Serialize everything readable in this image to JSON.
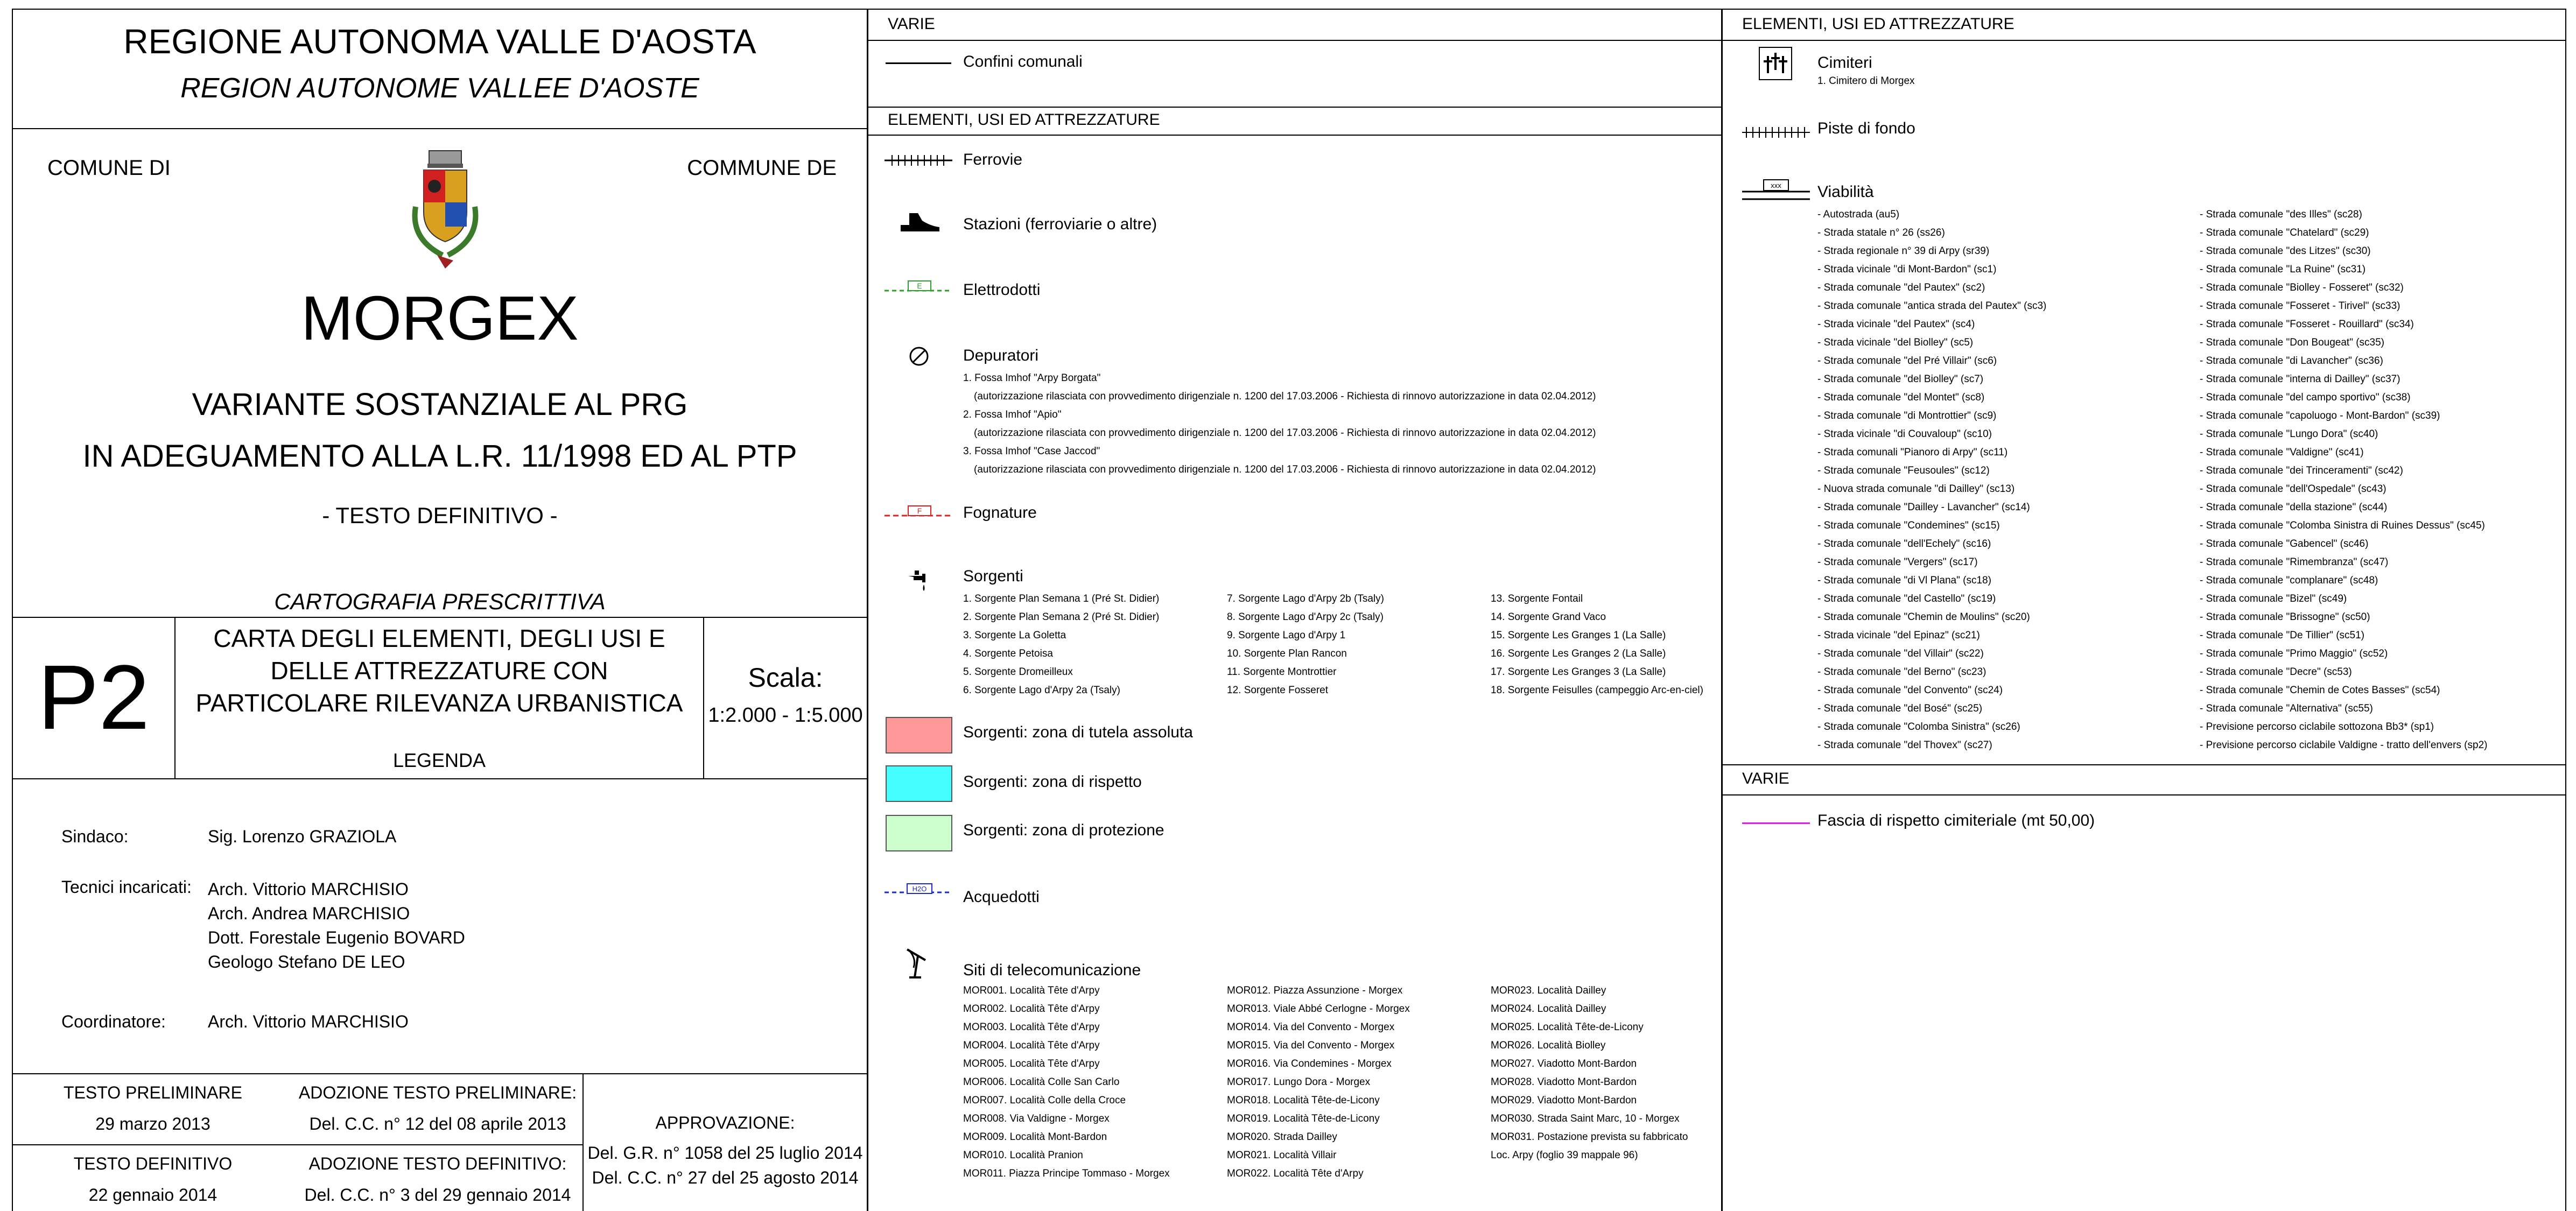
{
  "title_block": {
    "region_it": "REGIONE AUTONOMA VALLE D'AOSTA",
    "region_fr": "REGION AUTONOME VALLEE D'AOSTE",
    "comune_it": "COMUNE DI",
    "comune_fr": "COMMUNE DE",
    "town": "MORGEX",
    "variant_line1": "VARIANTE SOSTANZIALE AL PRG",
    "variant_line2": "IN ADEGUAMENTO ALLA L.R. 11/1998 ED AL PTP",
    "testo": "- TESTO DEFINITIVO -",
    "cartografia": "CARTOGRAFIA PRESCRITTIVA",
    "sheet_code": "P2",
    "sheet_title_1": "CARTA DEGLI ELEMENTI, DEGLI USI E",
    "sheet_title_2": "DELLE ATTREZZATURE CON",
    "sheet_title_3": "PARTICOLARE RILEVANZA URBANISTICA",
    "legenda": "LEGENDA",
    "scala_label": "Scala:",
    "scala_value": "1:2.000 - 1:5.000",
    "sindaco_label": "Sindaco:",
    "sindaco": "Sig. Lorenzo GRAZIOLA",
    "tecnici_label": "Tecnici incaricati:",
    "tecnici": [
      "Arch. Vittorio MARCHISIO",
      "Arch. Andrea MARCHISIO",
      "Dott. Forestale Eugenio BOVARD",
      "Geologo Stefano DE LEO"
    ],
    "coordinatore_label": "Coordinatore:",
    "coordinatore": "Arch. Vittorio MARCHISIO",
    "testo_prelim": "TESTO PRELIMINARE",
    "testo_prelim_date": "29 marzo 2013",
    "adozione_prelim": "ADOZIONE TESTO PRELIMINARE:",
    "adozione_prelim_val": "Del. C.C. n° 12 del 08 aprile 2013",
    "testo_def": "TESTO DEFINITIVO",
    "testo_def_date": "22 gennaio 2014",
    "adozione_def": "ADOZIONE TESTO DEFINITIVO:",
    "adozione_def_val": "Del. C.C. n° 3 del 29 gennaio 2014",
    "approvazione": "APPROVAZIONE:",
    "approvazione_1": "Del. G.R. n° 1058 del 25 luglio 2014",
    "approvazione_2": "Del. C.C. n° 27 del 25 agosto 2014"
  },
  "middle": {
    "varie_header": "VARIE",
    "confini": "Confini comunali",
    "elementi_header": "ELEMENTI, USI ED ATTREZZATURE",
    "ferrovie": "Ferrovie",
    "stazioni": "Stazioni (ferroviarie o altre)",
    "elettrodotti": "Elettrodotti",
    "elettro_symbol": "E",
    "depuratori": "Depuratori",
    "depuratori_items": [
      "1. Fossa Imhof \"Arpy Borgata\"",
      "(autorizzazione rilasciata con provvedimento dirigenziale n. 1200 del 17.03.2006 - Richiesta di rinnovo autorizzazione in data 02.04.2012)",
      "2. Fossa Imhof \"Apio\"",
      "(autorizzazione rilasciata con provvedimento dirigenziale n. 1200 del 17.03.2006 - Richiesta di rinnovo autorizzazione in data 02.04.2012)",
      "3. Fossa Imhof \"Case Jaccod\"",
      "(autorizzazione rilasciata con provvedimento dirigenziale n. 1200 del 17.03.2006 - Richiesta di rinnovo autorizzazione in data 02.04.2012)"
    ],
    "fognature": "Fognature",
    "fogn_symbol": "F",
    "sorgenti": "Sorgenti",
    "sorgenti_items": [
      "1. Sorgente Plan Semana 1 (Pré St. Didier)",
      "7. Sorgente Lago d'Arpy 2b (Tsaly)",
      "13. Sorgente Fontail",
      "2. Sorgente Plan Semana 2 (Pré St. Didier)",
      "8. Sorgente Lago d'Arpy 2c (Tsaly)",
      "14. Sorgente Grand Vaco",
      "3. Sorgente La Goletta",
      "9. Sorgente Lago d'Arpy 1",
      "15. Sorgente Les Granges 1 (La Salle)",
      "4. Sorgente Petoisa",
      "10. Sorgente Plan Rancon",
      "16. Sorgente Les Granges 2 (La Salle)",
      "5. Sorgente Dromeilleux",
      "11. Sorgente Montrottier",
      "17. Sorgente Les Granges 3 (La Salle)",
      "6. Sorgente Lago d'Arpy 2a (Tsaly)",
      "12. Sorgente Fosseret",
      "18. Sorgente Feisulles (campeggio Arc-en-ciel)"
    ],
    "zona_tutela": "Sorgenti: zona di tutela assoluta",
    "zona_rispetto": "Sorgenti: zona di rispetto",
    "zona_protezione": "Sorgenti: zona di protezione",
    "color_tutela": "#ff9999",
    "color_rispetto": "#44ffff",
    "color_protezione": "#ccffcc",
    "acquedotti": "Acquedotti",
    "acq_symbol": "H2O",
    "siti": "Siti di telecomunicazione",
    "siti_items": [
      "MOR001. Località Tête d'Arpy",
      "MOR012. Piazza Assunzione - Morgex",
      "MOR023. Località Dailley",
      "MOR002. Località Tête d'Arpy",
      "MOR013. Viale Abbé Cerlogne - Morgex",
      "MOR024. Località Dailley",
      "MOR003. Località Tête d'Arpy",
      "MOR014. Via del Convento - Morgex",
      "MOR025. Località Tête-de-Licony",
      "MOR004. Località Tête d'Arpy",
      "MOR015. Via del Convento - Morgex",
      "MOR026. Località Biolley",
      "MOR005. Località Tête d'Arpy",
      "MOR016. Via Condemines - Morgex",
      "MOR027. Viadotto Mont-Bardon",
      "MOR006. Località Colle San Carlo",
      "MOR017. Lungo Dora - Morgex",
      "MOR028. Viadotto Mont-Bardon",
      "MOR007. Località Colle della Croce",
      "MOR018. Località Tête-de-Licony",
      "MOR029. Viadotto Mont-Bardon",
      "MOR008. Via Valdigne - Morgex",
      "MOR019. Località Tête-de-Licony",
      "MOR030. Strada Saint Marc, 10 - Morgex",
      "MOR009. Località Mont-Bardon",
      "MOR020. Strada Dailley",
      "MOR031. Postazione prevista su fabbricato",
      "MOR010. Località Pranion",
      "MOR021. Località Villair",
      "Loc. Arpy (foglio 39 mappale 96)",
      "MOR011. Piazza Principe Tommaso - Morgex",
      "MOR022. Località Tête d'Arpy",
      ""
    ]
  },
  "right": {
    "elementi_header": "ELEMENTI, USI ED ATTREZZATURE",
    "cimiteri": "Cimiteri",
    "cimiteri_item": "1. Cimitero di Morgex",
    "piste": "Piste di fondo",
    "viabilita": "Viabilità",
    "via_symbol": "xxx",
    "viabilita_items": [
      "- Autostrada (au5)",
      "- Strada comunale \"des Illes\" (sc28)",
      "- Strada statale n° 26 (ss26)",
      "- Strada comunale \"Chatelard\" (sc29)",
      "- Strada regionale n° 39 di Arpy (sr39)",
      "- Strada comunale \"des Litzes\" (sc30)",
      "- Strada vicinale \"di Mont-Bardon\" (sc1)",
      "- Strada comunale \"La Ruine\" (sc31)",
      "- Strada comunale \"del Pautex\" (sc2)",
      "- Strada comunale \"Biolley - Fosseret\" (sc32)",
      "- Strada comunale \"antica strada del Pautex\" (sc3)",
      "- Strada comunale \"Fosseret - Tirivel\" (sc33)",
      "- Strada vicinale \"del Pautex\" (sc4)",
      "- Strada comunale \"Fosseret - Rouillard\" (sc34)",
      "- Strada vicinale \"del Biolley\" (sc5)",
      "- Strada comunale \"Don Bougeat\" (sc35)",
      "- Strada comunale \"del Pré Villair\" (sc6)",
      "- Strada comunale \"di Lavancher\" (sc36)",
      "- Strada comunale \"del Biolley\" (sc7)",
      "- Strada comunale \"interna di Dailley\" (sc37)",
      "- Strada comunale \"del Montet\" (sc8)",
      "- Strada comunale \"del campo sportivo\" (sc38)",
      "- Strada comunale \"di Montrottier\" (sc9)",
      "- Strada comunale \"capoluogo - Mont-Bardon\" (sc39)",
      "- Strada vicinale \"di Couvaloup\" (sc10)",
      "- Strada comunale \"Lungo Dora\" (sc40)",
      "- Strada comunali \"Pianoro di Arpy\" (sc11)",
      "- Strada comunale \"Valdigne\" (sc41)",
      "- Strada comunale \"Feusoules\" (sc12)",
      "- Strada comunale \"dei Trinceramenti\" (sc42)",
      "- Nuova strada comunale \"di Dailley\" (sc13)",
      "- Strada comunale \"dell'Ospedale\" (sc43)",
      "- Strada comunale \"Dailley - Lavancher\" (sc14)",
      "- Strada comunale \"della stazione\" (sc44)",
      "- Strada comunale \"Condemines\" (sc15)",
      "- Strada comunale \"Colomba Sinistra di Ruines Dessus\" (sc45)",
      "- Strada comunale \"dell'Echely\" (sc16)",
      "- Strada comunale \"Gabencel\" (sc46)",
      "- Strada comunale \"Vergers\" (sc17)",
      "- Strada comunale \"Rimembranza\" (sc47)",
      "- Strada comunale \"di Vl Plana\" (sc18)",
      "- Strada comunale \"complanare\" (sc48)",
      "- Strada comunale \"del Castello\" (sc19)",
      "- Strada comunale \"Bizel\" (sc49)",
      "- Strada comunale \"Chemin de Moulins\" (sc20)",
      "- Strada comunale \"Brissogne\" (sc50)",
      "- Strada vicinale \"del Epinaz\" (sc21)",
      "- Strada comunale \"De Tillier\" (sc51)",
      "- Strada comunale \"del Villair\" (sc22)",
      "- Strada comunale \"Primo Maggio\" (sc52)",
      "- Strada comunale \"del Berno\" (sc23)",
      "- Strada comunale \"Decre\" (sc53)",
      "- Strada comunale \"del Convento\" (sc24)",
      "- Strada comunale \"Chemin de Cotes Basses\" (sc54)",
      "- Strada comunale \"del Bosé\" (sc25)",
      "- Strada comunale \"Alternativa\" (sc55)",
      "- Strada comunale \"Colomba Sinistra\" (sc26)",
      "- Previsione percorso ciclabile sottozona Bb3* (sp1)",
      "- Strada comunale \"del Thovex\" (sc27)",
      "- Previsione percorso ciclabile Valdigne - tratto dell'envers (sp2)"
    ],
    "varie_header": "VARIE",
    "fascia": "Fascia di rispetto cimiteriale (mt 50,00)",
    "fascia_color": "#e020e0"
  }
}
